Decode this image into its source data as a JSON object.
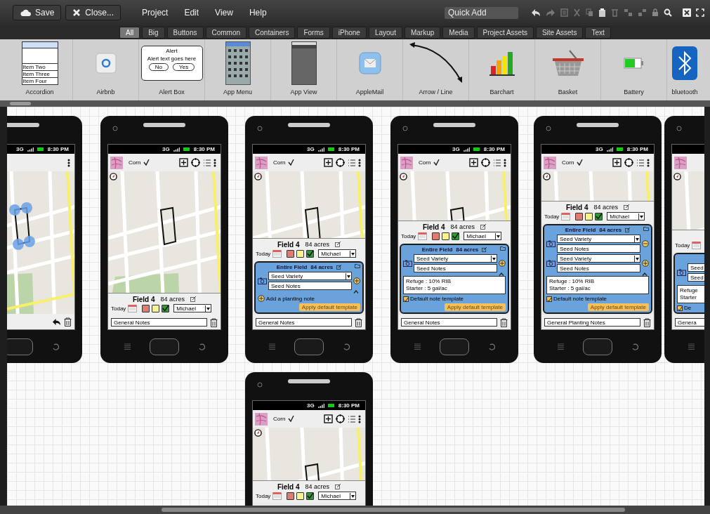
{
  "toolbar": {
    "buttons": [
      {
        "label": "Save",
        "kind": "save"
      },
      {
        "label": "Close...",
        "kind": "close"
      }
    ],
    "menus": [
      "Project",
      "Edit",
      "View",
      "Help"
    ],
    "quick_add": {
      "placeholder": "Quick Add"
    }
  },
  "categories": [
    {
      "label": "All",
      "selected": true
    },
    {
      "label": "Big",
      "selected": false
    },
    {
      "label": "Buttons",
      "selected": false
    },
    {
      "label": "Common",
      "selected": false
    },
    {
      "label": "Containers",
      "selected": false
    },
    {
      "label": "Forms",
      "selected": false
    },
    {
      "label": "iPhone",
      "selected": false
    },
    {
      "label": "Layout",
      "selected": false
    },
    {
      "label": "Markup",
      "selected": false
    },
    {
      "label": "Media",
      "selected": false
    },
    {
      "label": "Project Assets",
      "selected": false
    },
    {
      "label": "Site Assets",
      "selected": false
    },
    {
      "label": "Text",
      "selected": false
    }
  ],
  "library": [
    {
      "label": "Accordion",
      "kind": "accordion",
      "preview": [
        "Item Two",
        "Item Three",
        "Item Four"
      ]
    },
    {
      "label": "Airbnb",
      "kind": "airbnb"
    },
    {
      "label": "Alert Box",
      "kind": "alert",
      "preview": [
        "Alert",
        "Alert text goes here",
        "No",
        "Yes"
      ]
    },
    {
      "label": "App Menu",
      "kind": "app-menu"
    },
    {
      "label": "App View",
      "kind": "app-view"
    },
    {
      "label": "AppleMail",
      "kind": "mail"
    },
    {
      "label": "Arrow / Line",
      "kind": "arrow"
    },
    {
      "label": "Barchart",
      "kind": "barchart"
    },
    {
      "label": "Basket",
      "kind": "basket"
    },
    {
      "label": "Battery",
      "kind": "battery"
    },
    {
      "label": "bluetooth",
      "kind": "bluetooth"
    }
  ],
  "phones": [
    {
      "status": {
        "network": "3G",
        "time": "8:30 PM"
      },
      "app_bar": {
        "tools": false
      },
      "map": {
        "handles": true
      },
      "bottom": {
        "kind": "edit"
      }
    },
    {
      "status": {
        "network": "3G",
        "time": "8:30 PM"
      },
      "app_bar": {
        "crop": "Corn",
        "tools": true
      },
      "map": {
        "handles": false
      },
      "field_panel": {
        "title": "Field 4",
        "area": "84 acres",
        "date_label": "Today",
        "statuses": [
          {
            "color": "#e07b72",
            "selected": false
          },
          {
            "color": "#f7f38f",
            "selected": false
          },
          {
            "color": "#2f9a35",
            "selected": true
          }
        ],
        "person": "Michael"
      },
      "bottom": {
        "kind": "notes",
        "value": "General Notes"
      }
    },
    {
      "status": {
        "network": "3G",
        "time": "8:30 PM"
      },
      "app_bar": {
        "crop": "Corn",
        "tools": true
      },
      "map": {
        "handles": false
      },
      "field_panel": {
        "title": "Field 4",
        "area": "84 acres",
        "date_label": "Today",
        "statuses": [
          {
            "color": "#e07b72",
            "selected": false
          },
          {
            "color": "#f7f38f",
            "selected": false
          },
          {
            "color": "#2f9a35",
            "selected": true
          }
        ],
        "person": "Michael"
      },
      "note_panel": {
        "title": "Entire Field",
        "area": "84 acres",
        "entries": [
          {
            "variety": "Seed Variety",
            "notes": "Seed Notes",
            "kind": "add"
          }
        ],
        "footer": {
          "kind": "add-note",
          "label": "Add a planting note",
          "button": "Apply default template"
        }
      },
      "bottom": {
        "kind": "notes",
        "value": "General Notes"
      }
    },
    {
      "status": {
        "network": "3G",
        "time": "8:30 PM"
      },
      "app_bar": {
        "crop": "Corn",
        "tools": true
      },
      "map": {
        "handles": false
      },
      "field_panel": {
        "title": "Field 4",
        "area": "84 acres",
        "date_label": "Today",
        "statuses": [
          {
            "color": "#e07b72",
            "selected": false
          },
          {
            "color": "#f7f38f",
            "selected": false
          },
          {
            "color": "#2f9a35",
            "selected": true
          }
        ],
        "person": "Michael"
      },
      "note_panel": {
        "title": "Entire Field",
        "area": "84 acres",
        "entries": [
          {
            "variety": "Seed Variety",
            "notes": "Seed Notes",
            "kind": "add"
          }
        ],
        "text": [
          "Refuge : 10% RIB",
          "Starter : 5 gal/ac"
        ],
        "footer": {
          "kind": "template",
          "label": "Default note template",
          "checked": true,
          "button": "Apply default template"
        }
      },
      "bottom": {
        "kind": "notes",
        "value": "General Notes"
      }
    },
    {
      "status": {
        "network": "3G",
        "time": "8:30 PM"
      },
      "app_bar": {
        "crop": "Corn",
        "tools": true
      },
      "field_panel": {
        "title": "Field 4",
        "area": "84 acres",
        "date_label": "Today",
        "statuses": [
          {
            "color": "#e07b72",
            "selected": false
          },
          {
            "color": "#f7f38f",
            "selected": false
          },
          {
            "color": "#2f9a35",
            "selected": true
          }
        ],
        "person": "Michael"
      },
      "note_panel": {
        "title": "Entire Field",
        "area": "84 acres",
        "entries": [
          {
            "variety": "Seed Variety",
            "notes": "Seed Notes",
            "kind": "remove"
          },
          {
            "variety": "Seed Variety",
            "notes": "Seed Notes",
            "kind": "add"
          }
        ],
        "text": [
          "Refuge : 10% RIB",
          "Starter : 5 gal/ac"
        ],
        "footer": {
          "kind": "template",
          "label": "Default note template",
          "checked": true,
          "button": "Apply default template"
        }
      },
      "bottom": {
        "kind": "notes",
        "value": "General Planting Notes"
      }
    },
    {
      "field_panel": {
        "date_label": "Today"
      },
      "note_panel": {
        "entries": [
          {
            "variety": "Seed",
            "notes": "Seed"
          }
        ],
        "text": [
          "Refuge",
          "Starter"
        ],
        "footer": {
          "kind": "template",
          "label": "De",
          "checked": true
        }
      },
      "bottom": {
        "kind": "notes",
        "value": "Genera"
      }
    },
    {
      "status": {
        "network": "3G",
        "time": "8:30 PM"
      },
      "app_bar": {
        "crop": "Corn",
        "tools": true
      },
      "map": {
        "handles": false
      },
      "field_panel": {
        "title": "Field 4",
        "area": "84 acres",
        "date_label": "Today",
        "statuses": [
          {
            "color": "#e07b72",
            "selected": false
          },
          {
            "color": "#f7f38f",
            "selected": false
          },
          {
            "color": "#2f9a35",
            "selected": true
          }
        ],
        "person": "Michael"
      }
    }
  ]
}
